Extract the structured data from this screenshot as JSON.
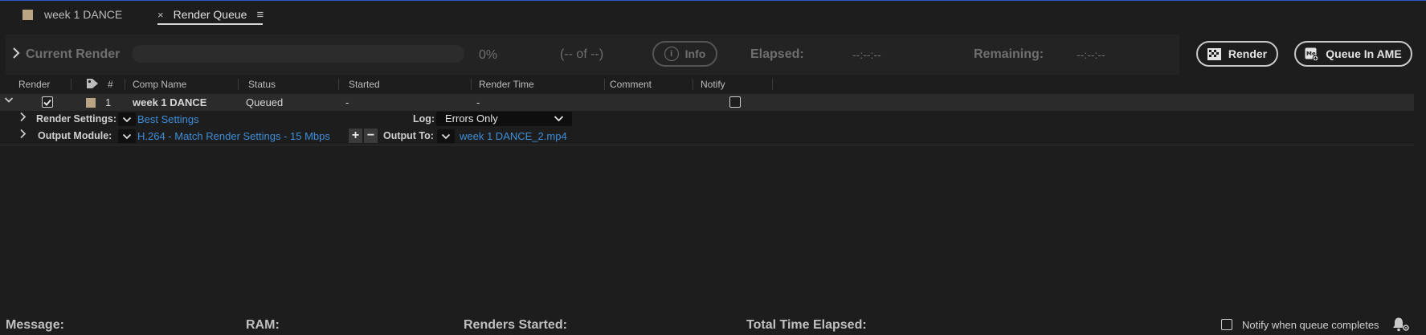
{
  "tabs": [
    {
      "label": "week 1 DANCE"
    },
    {
      "label": "Render Queue",
      "close": "×",
      "menu": "≡"
    }
  ],
  "current_render": {
    "title": "Current Render",
    "progress_pct": "0%",
    "progress_fraction": 0,
    "count": "(-- of --)",
    "info_label": "Info",
    "elapsed_label": "Elapsed:",
    "elapsed_value": "--:--:--",
    "remaining_label": "Remaining:",
    "remaining_value": "--:--:--"
  },
  "buttons": {
    "render": "Render",
    "queue_in_ame": "Queue In AME"
  },
  "columns": {
    "render": "Render",
    "number": "#",
    "comp_name": "Comp Name",
    "status": "Status",
    "started": "Started",
    "render_time": "Render Time",
    "comment": "Comment",
    "notify": "Notify"
  },
  "item": {
    "number": "1",
    "comp_name": "week 1 DANCE",
    "status": "Queued",
    "started": "-",
    "render_time": "-",
    "render_checked": true,
    "notify_checked": false,
    "label_color": "#b9a583"
  },
  "render_settings": {
    "label": "Render Settings:",
    "value": "Best Settings",
    "log_label": "Log:",
    "log_value": "Errors Only"
  },
  "output_module": {
    "label": "Output Module:",
    "value": "H.264 - Match Render Settings - 15 Mbps",
    "output_to_label": "Output To:",
    "output_to_value": "week 1 DANCE_2.mp4"
  },
  "footer": {
    "message_label": "Message:",
    "ram_label": "RAM:",
    "renders_started_label": "Renders Started:",
    "total_time_label": "Total Time Elapsed:",
    "notify_label": "Notify when queue completes"
  },
  "colors": {
    "accent_link": "#3e8ed9",
    "window_border": "#2f5bd0",
    "background": "#1d1d1d"
  },
  "icons": [
    "chevron-right-icon",
    "info-icon",
    "render-icon",
    "media-encoder-icon",
    "tag-icon",
    "check-icon",
    "chevron-down-icon",
    "plus-icon",
    "minus-icon",
    "bell-gear-icon",
    "close-icon",
    "menu-icon"
  ]
}
